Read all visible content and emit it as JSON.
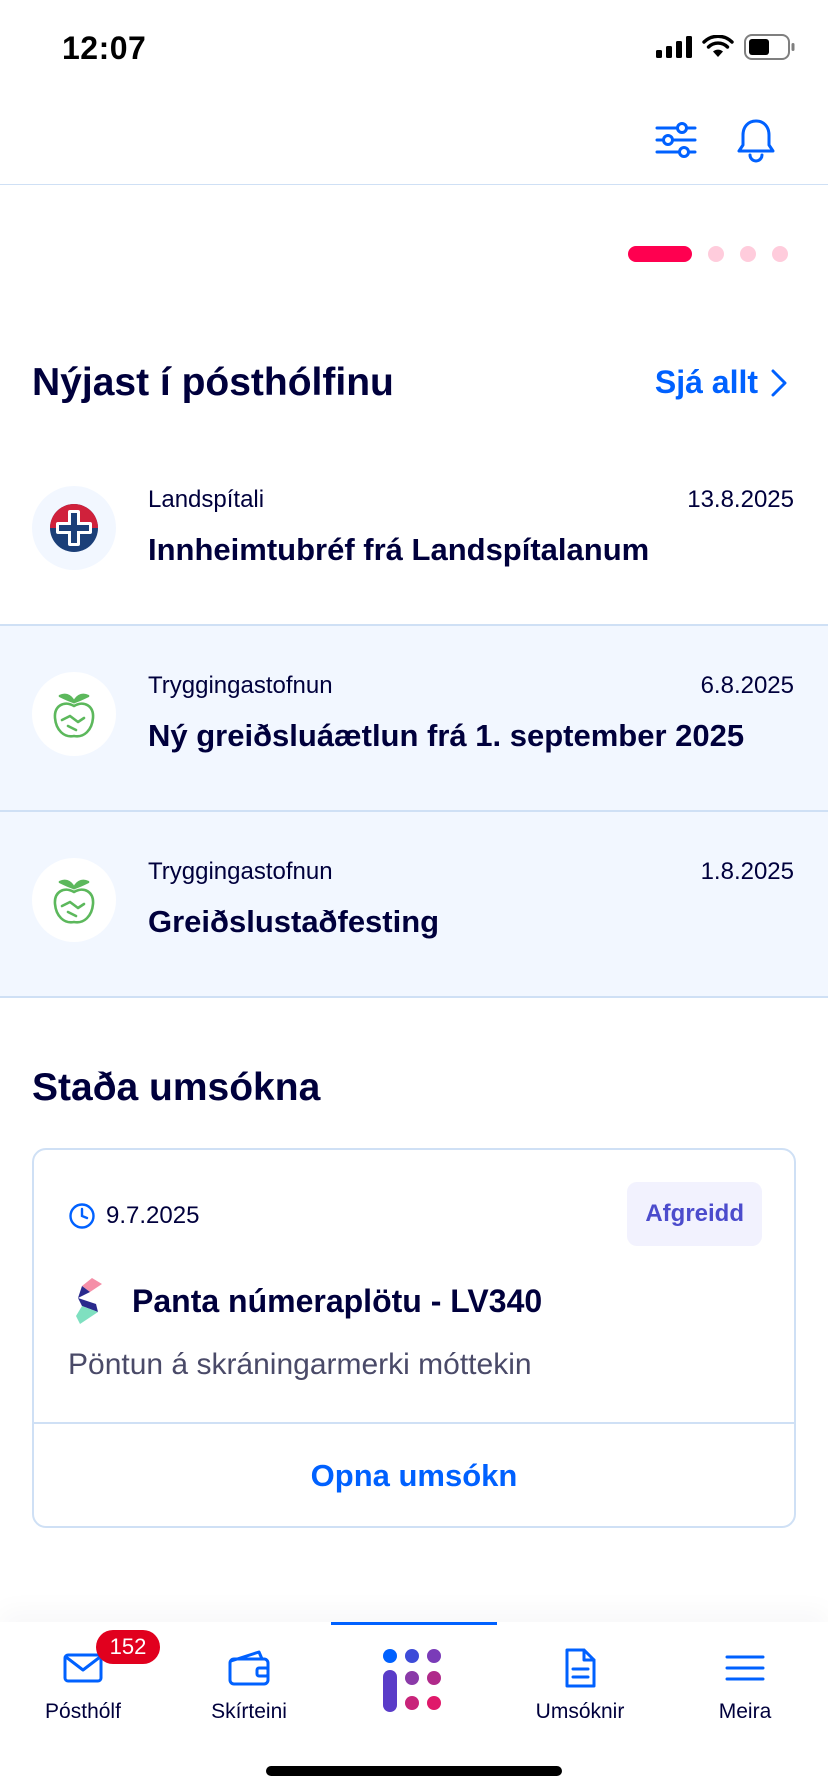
{
  "status_bar": {
    "time": "12:07"
  },
  "header": {
    "filter_icon": "sliders-icon",
    "bell_icon": "bell-icon"
  },
  "carousel": {
    "total_pages": 4,
    "active_page": 1
  },
  "inbox": {
    "title": "Nýjast í pósthólfinu",
    "see_all_label": "Sjá allt",
    "items": [
      {
        "sender": "Landspítali",
        "date": "13.8.2025",
        "title": "Innheimtubréf frá Landspítalanum",
        "unread": false,
        "icon": "landspitali-logo"
      },
      {
        "sender": "Tryggingastofnun",
        "date": "6.8.2025",
        "title": "Ný greiðsluáætlun frá 1. september 2025",
        "unread": true,
        "icon": "tryggingastofnun-logo"
      },
      {
        "sender": "Tryggingastofnun",
        "date": "1.8.2025",
        "title": "Greiðslustaðfesting",
        "unread": true,
        "icon": "tryggingastofnun-logo"
      }
    ]
  },
  "applications": {
    "title": "Staða umsókna",
    "card": {
      "date": "9.7.2025",
      "status": "Afgreidd",
      "title": "Panta númeraplötu - LV340",
      "description": "Pöntun á skráningarmerki móttekin",
      "open_label": "Opna umsókn"
    }
  },
  "tabbar": {
    "tabs": [
      {
        "label": "Pósthólf",
        "icon": "mail-icon",
        "badge": "152"
      },
      {
        "label": "Skírteini",
        "icon": "wallet-icon"
      },
      {
        "label": "",
        "icon": "island-logo-icon",
        "active": true
      },
      {
        "label": "Umsóknir",
        "icon": "document-icon"
      },
      {
        "label": "Meira",
        "icon": "menu-icon"
      }
    ]
  },
  "colors": {
    "accent": "#0061ff",
    "brand_red": "#ff0050",
    "unread_bg": "#f2f7ff",
    "border": "#cfe0f5",
    "text": "#00003c"
  }
}
